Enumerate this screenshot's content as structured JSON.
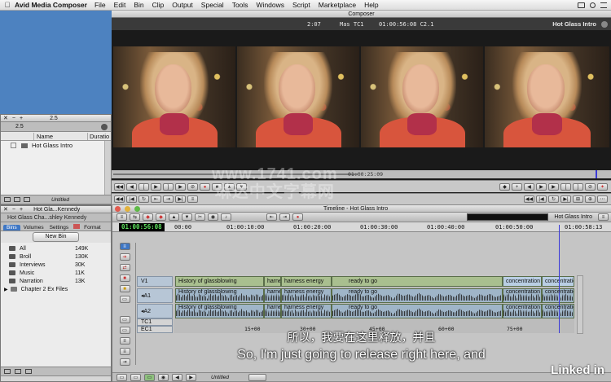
{
  "menubar": {
    "app_name": "Avid Media Composer",
    "items": [
      "File",
      "Edit",
      "Bin",
      "Clip",
      "Output",
      "Special",
      "Tools",
      "Windows",
      "Script",
      "Marketplace",
      "Help"
    ]
  },
  "bin_window": {
    "title": "2.5",
    "tab": "2.5",
    "columns": [
      "Name",
      "Duratio"
    ],
    "items": [
      "Hot Glass Intro"
    ],
    "view_label": "Untitled"
  },
  "composer": {
    "title": "Composer",
    "duration": "2:07",
    "track_label": "Mas TC1",
    "timecode": "01:00:56:08 C2.1",
    "sequence_name": "Hot Glass Intro",
    "scrub_timecode": "01:00:25:09"
  },
  "bin2": {
    "window_title": "Hot Gla...Kennedy",
    "project_title": "Hot Glass Cha...shley Kennedy",
    "tabs": [
      "Bins",
      "Volumes",
      "Settings",
      "Format"
    ],
    "new_bin_label": "New Bin",
    "bins": [
      {
        "name": "All",
        "size": "149K"
      },
      {
        "name": "Broll",
        "size": "130K"
      },
      {
        "name": "Interviews",
        "size": "30K"
      },
      {
        "name": "Music",
        "size": "11K"
      },
      {
        "name": "Narration",
        "size": "13K"
      },
      {
        "name": "Chapter 2 Ex Files",
        "size": ""
      }
    ],
    "view_label": "Untitled"
  },
  "timeline": {
    "title": "Timeline - Hot Glass Intro",
    "timecode": "01:00:56:08",
    "ruler": [
      "00:00",
      "01:00:10:00",
      "01:00:20:00",
      "01:00:30:00",
      "01:00:40:00",
      "01:00:50:00",
      "01:00:58:13"
    ],
    "tracks": {
      "v1": "V1",
      "a1": "A1",
      "a2": "A2",
      "tc1": "TC1",
      "ec1": "EC1"
    },
    "video_clips": [
      "History of glassblowing",
      "harnes",
      "harness energy",
      "ready to go",
      "concentration",
      "concentratio"
    ],
    "audio_clips": [
      "History of glassblowing",
      "harnes",
      "harness energy",
      "ready to go",
      "concentration",
      "concentratio"
    ],
    "ec_marks": [
      "15+00",
      "30+00",
      "45+00",
      "60+00",
      "75+00"
    ],
    "view_label": "Untitled"
  },
  "subtitles": {
    "chinese": "所以，我要在这里释放，并且",
    "english": "So, I'm just going to release right here, and"
  },
  "watermark": {
    "line1": "www.1741.com",
    "line2": "琳达中文字幕网"
  },
  "brand": "Linked in",
  "colors": {
    "desktop": "#4d82c0",
    "timecode_green": "#5fe35f",
    "video_clip": "#a9bf8f",
    "audio_clip": "#9fb5c8",
    "playhead": "#3a3ad8"
  }
}
